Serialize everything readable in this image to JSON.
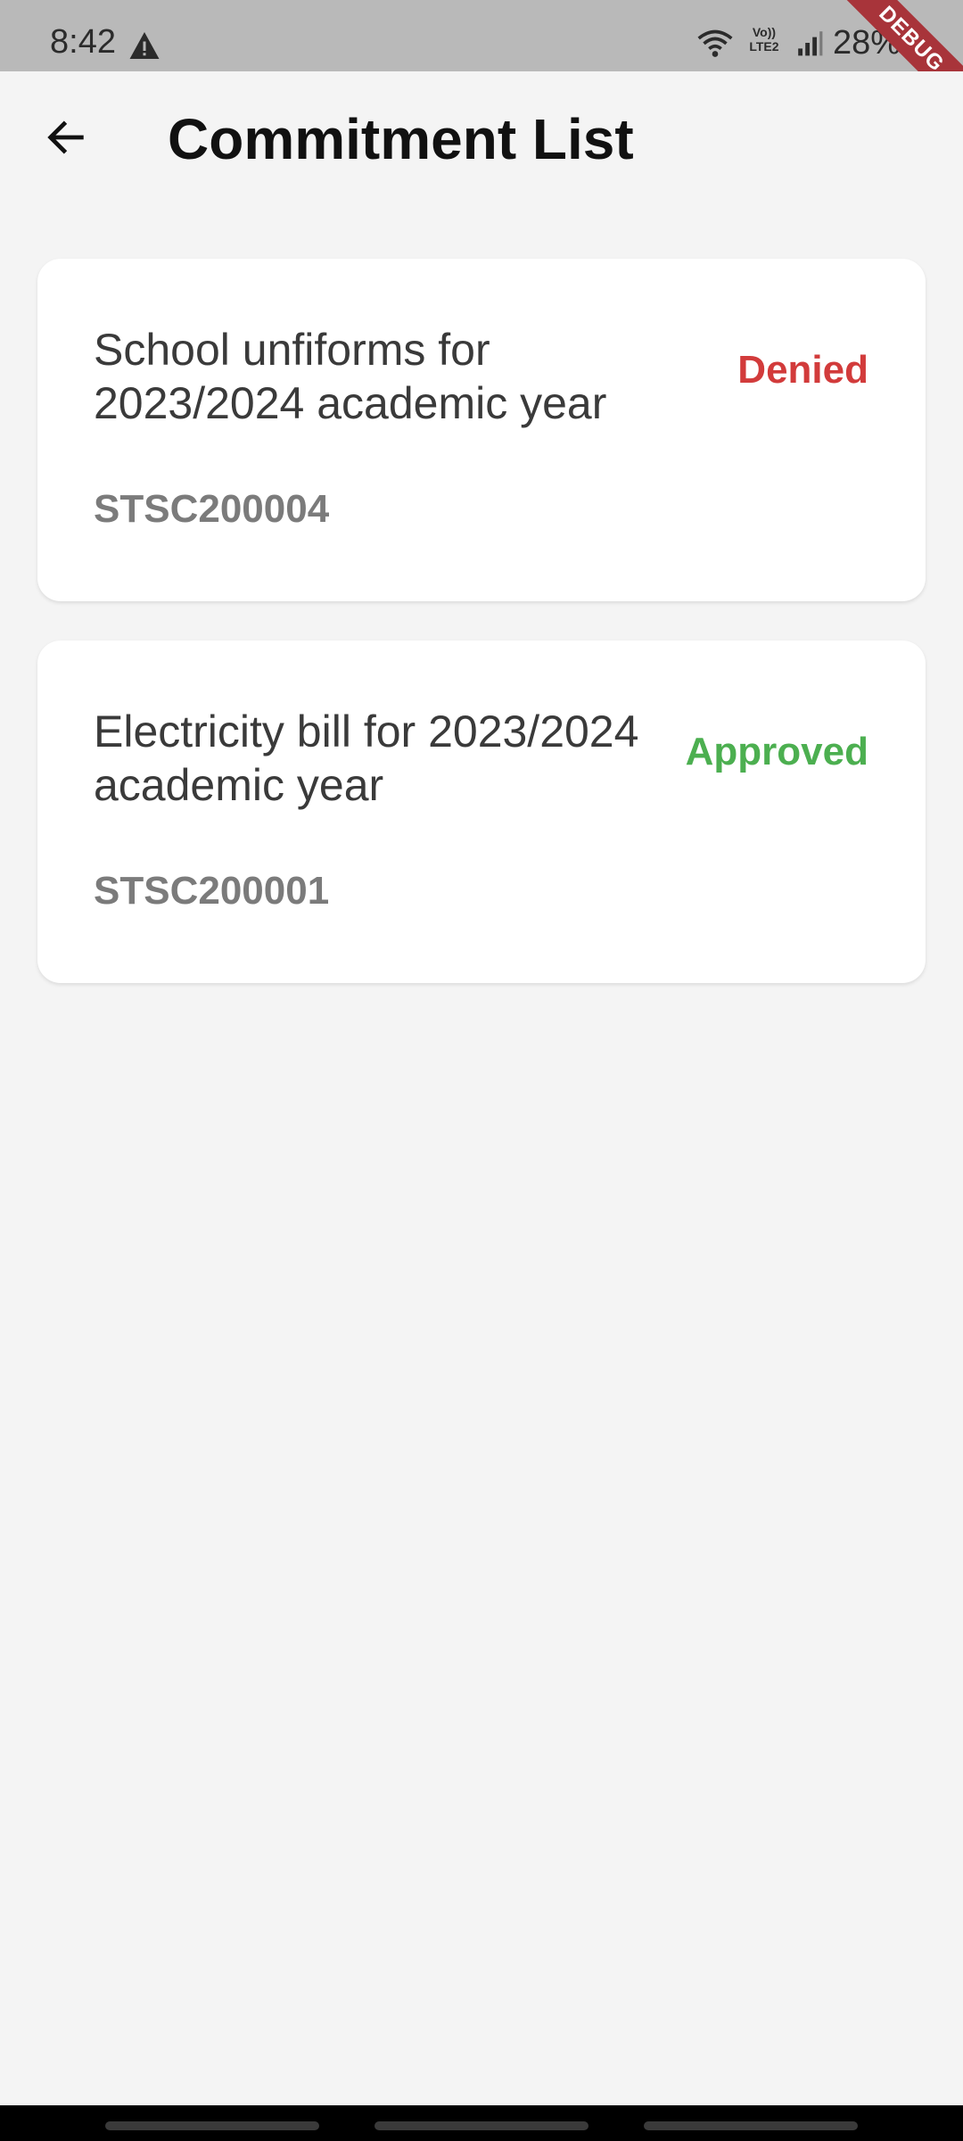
{
  "status_bar": {
    "time": "8:42",
    "battery": "28%",
    "network_label": "Vo)) LTE2",
    "icons": [
      "warning-icon",
      "wifi-icon",
      "volte-icon",
      "signal-icon"
    ]
  },
  "debug_banner": "DEBUG",
  "header": {
    "title": "Commitment List",
    "back_icon": "arrow-left-icon"
  },
  "commitments": [
    {
      "title": "School unfiforms for 2023/2024 academic year",
      "status": "Denied",
      "status_color": "#d23b3b",
      "code": "STSC200004"
    },
    {
      "title": "Electricity bill for 2023/2024 academic year",
      "status": "Approved",
      "status_color": "#4caf50",
      "code": "STSC200001"
    }
  ],
  "colors": {
    "background": "#f4f4f4",
    "card": "#ffffff",
    "status_bar": "#b9b9b9",
    "debug_banner": "#a8343a"
  }
}
